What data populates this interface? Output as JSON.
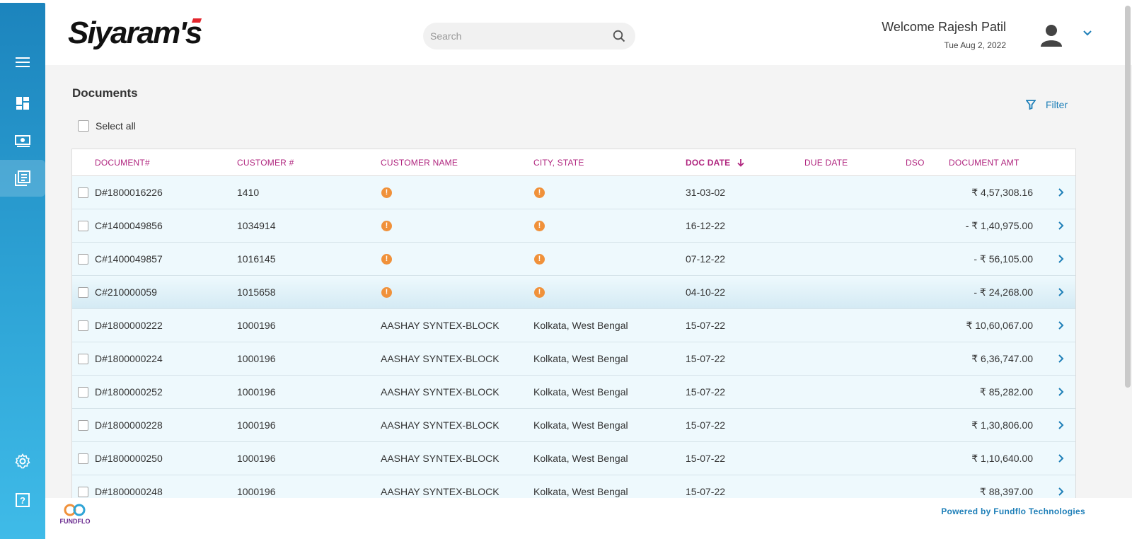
{
  "app": {
    "logo_text": "Siyaram's"
  },
  "header": {
    "search_placeholder": "Search",
    "welcome": "Welcome Rajesh Patil",
    "date": "Tue Aug 2, 2022"
  },
  "sidebar": {
    "items": [
      {
        "name": "menu-icon"
      },
      {
        "name": "dashboard-icon"
      },
      {
        "name": "payments-icon"
      },
      {
        "name": "documents-icon",
        "active": true
      },
      {
        "name": "settings-icon"
      },
      {
        "name": "help-icon"
      }
    ]
  },
  "page": {
    "title": "Documents",
    "select_all": "Select all",
    "filter": "Filter"
  },
  "table": {
    "headers": {
      "document": "DOCUMENT#",
      "customer": "CUSTOMER #",
      "customer_name": "CUSTOMER NAME",
      "city_state": "CITY, STATE",
      "doc_date": "DOC DATE",
      "due_date": "DUE DATE",
      "dso": "DSO",
      "amount": "DOCUMENT AMT"
    },
    "rows": [
      {
        "doc": "D#1800016226",
        "cust": "1410",
        "name": "",
        "city": "",
        "warn": true,
        "date": "31-03-02",
        "amt": "₹ 4,57,308.16"
      },
      {
        "doc": "C#1400049856",
        "cust": "1034914",
        "name": "",
        "city": "",
        "warn": true,
        "date": "16-12-22",
        "amt": "- ₹ 1,40,975.00"
      },
      {
        "doc": "C#1400049857",
        "cust": "1016145",
        "name": "",
        "city": "",
        "warn": true,
        "date": "07-12-22",
        "amt": "- ₹ 56,105.00"
      },
      {
        "doc": "C#210000059",
        "cust": "1015658",
        "name": "",
        "city": "",
        "warn": true,
        "date": "04-10-22",
        "amt": "- ₹ 24,268.00"
      },
      {
        "doc": "D#1800000222",
        "cust": "1000196",
        "name": "AASHAY SYNTEX-BLOCK",
        "city": "Kolkata, West Bengal",
        "warn": false,
        "date": "15-07-22",
        "amt": "₹ 10,60,067.00"
      },
      {
        "doc": "D#1800000224",
        "cust": "1000196",
        "name": "AASHAY SYNTEX-BLOCK",
        "city": "Kolkata, West Bengal",
        "warn": false,
        "date": "15-07-22",
        "amt": "₹ 6,36,747.00"
      },
      {
        "doc": "D#1800000252",
        "cust": "1000196",
        "name": "AASHAY SYNTEX-BLOCK",
        "city": "Kolkata, West Bengal",
        "warn": false,
        "date": "15-07-22",
        "amt": "₹ 85,282.00"
      },
      {
        "doc": "D#1800000228",
        "cust": "1000196",
        "name": "AASHAY SYNTEX-BLOCK",
        "city": "Kolkata, West Bengal",
        "warn": false,
        "date": "15-07-22",
        "amt": "₹ 1,30,806.00"
      },
      {
        "doc": "D#1800000250",
        "cust": "1000196",
        "name": "AASHAY SYNTEX-BLOCK",
        "city": "Kolkata, West Bengal",
        "warn": false,
        "date": "15-07-22",
        "amt": "₹ 1,10,640.00"
      },
      {
        "doc": "D#1800000248",
        "cust": "1000196",
        "name": "AASHAY SYNTEX-BLOCK",
        "city": "Kolkata, West Bengal",
        "warn": false,
        "date": "15-07-22",
        "amt": "₹ 88,397.00"
      }
    ]
  },
  "footer": {
    "brand": "FUNDFLO",
    "powered_by": "Powered by Fundflo Technologies"
  },
  "colors": {
    "sidebar_top": "#1c84bd",
    "sidebar_bottom": "#3fbbe8",
    "header_text": "#b0267f",
    "link": "#1e7fb8",
    "warning": "#f0913a",
    "row_bg": "#eef9fd"
  }
}
